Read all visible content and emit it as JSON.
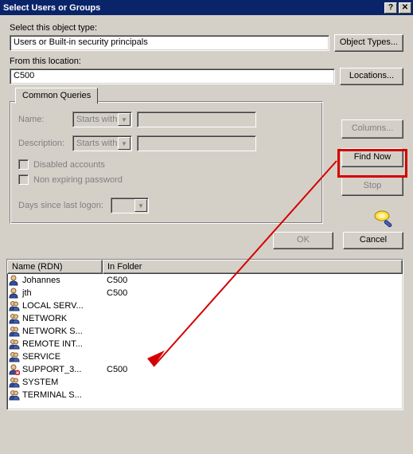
{
  "window": {
    "title": "Select Users or Groups"
  },
  "objectType": {
    "label": "Select this object type:",
    "value": "Users or Built-in security principals",
    "button": "Object Types..."
  },
  "location": {
    "label": "From this location:",
    "value": "C500",
    "button": "Locations..."
  },
  "queries": {
    "tab": "Common Queries",
    "nameLabel": "Name:",
    "nameMode": "Starts with",
    "descLabel": "Description:",
    "descMode": "Starts with",
    "disabled": "Disabled accounts",
    "nonexp": "Non expiring password",
    "daysLabel": "Days since last logon:"
  },
  "sideButtons": {
    "columns": "Columns...",
    "findNow": "Find Now",
    "stop": "Stop"
  },
  "bottom": {
    "ok": "OK",
    "cancel": "Cancel"
  },
  "list": {
    "col1": "Name (RDN)",
    "col2": "In Folder",
    "rows": [
      {
        "name": "Johannes",
        "folder": "C500",
        "icon": "user"
      },
      {
        "name": "jth",
        "folder": "C500",
        "icon": "user"
      },
      {
        "name": "LOCAL SERV...",
        "folder": "",
        "icon": "group"
      },
      {
        "name": "NETWORK",
        "folder": "",
        "icon": "group"
      },
      {
        "name": "NETWORK S...",
        "folder": "",
        "icon": "group"
      },
      {
        "name": "REMOTE INT...",
        "folder": "",
        "icon": "group"
      },
      {
        "name": "SERVICE",
        "folder": "",
        "icon": "group"
      },
      {
        "name": "SUPPORT_3...",
        "folder": "C500",
        "icon": "user-x"
      },
      {
        "name": "SYSTEM",
        "folder": "",
        "icon": "group"
      },
      {
        "name": "TERMINAL S...",
        "folder": "",
        "icon": "group"
      }
    ]
  },
  "colors": {
    "highlight": "#d40000"
  }
}
